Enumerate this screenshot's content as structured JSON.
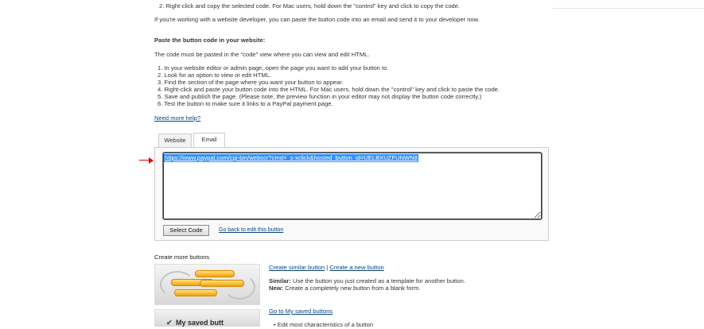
{
  "instructions_top": {
    "step2_line": "2. Right-click and copy the selected code. For Mac users, hold down the \"control\" key and click to copy the code.",
    "developer_note": "If you're working with a website developer, you can paste the button code into an email and send it to your developer now."
  },
  "paste_section": {
    "heading": "Paste the button code in your website:",
    "intro": "The code must be pasted in the \"code\" view where you can view and edit HTML.",
    "steps": [
      "1. In your website editor or admin page, open the page you want to add your button to.",
      "2. Look for an option to view or edit HTML.",
      "3. Find the section of the page where you want your button to appear.",
      "4. Right-click and paste your button code into the HTML. For Mac users, hold down the \"control\" key and click to paste the code.",
      "5. Save and publish the page. (Please note, the preview function in your editor may not display the button code correctly.)",
      "6. Test the button to make sure it links to a PayPal payment page."
    ],
    "help_link": "Need more help?"
  },
  "code_tabs": {
    "tabs": [
      "Website",
      "Email"
    ],
    "active": "Email",
    "code_value": "https://www.paypal.com/cgi-bin/webscr?cmd=_s-xclick&hosted_button_id=UELBXUZFUNWN8",
    "select_button": "Select Code",
    "back_link": "Go back to edit this button"
  },
  "more_buttons": {
    "heading": "Create more buttons",
    "similar_link": "Create similar button",
    "separator": "|",
    "new_link": "Create a new button",
    "similar_label": "Similar:",
    "similar_text": "Use the button you just created as a template for another button.",
    "new_label": "New:",
    "new_text": "Create a completely new button from a blank form.",
    "saved_link": "Go to My saved buttons",
    "saved_bullet": "Edit most characteristics of a button",
    "thumb2_text": "My saved butt"
  },
  "colors": {
    "link": "#084482",
    "selection": "#3390ff",
    "arrow": "#e60000"
  },
  "icons": {
    "arrow": "red-arrow-icon"
  }
}
